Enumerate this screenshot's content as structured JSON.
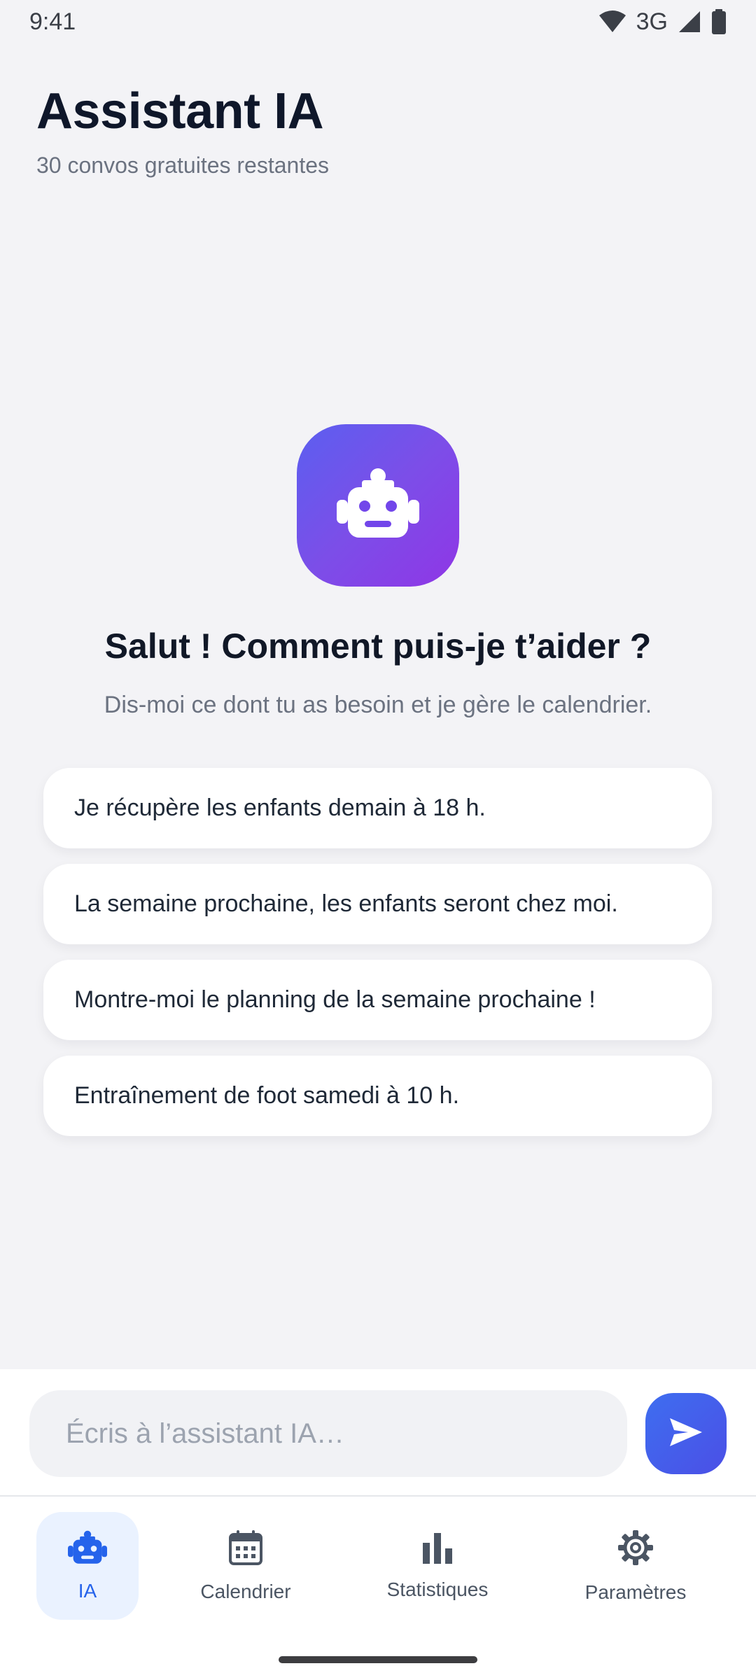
{
  "status_bar": {
    "time": "9:41",
    "network": "3G",
    "icons": [
      "wifi-icon",
      "signal-icon",
      "battery-icon"
    ]
  },
  "header": {
    "title": "Assistant IA",
    "subtitle": "30 convos gratuites restantes"
  },
  "hero": {
    "icon": "robot-icon",
    "greeting": "Salut ! Comment puis-je t’aider ?",
    "subtext": "Dis-moi ce dont tu as besoin et je gère le calendrier."
  },
  "suggestions": [
    "Je récupère les enfants demain à 18 h.",
    "La semaine prochaine, les enfants seront chez moi.",
    "Montre-moi le planning de la semaine prochaine !",
    "Entraînement de foot samedi à 10 h."
  ],
  "input": {
    "placeholder": "Écris à l’assistant IA…",
    "value": "",
    "send_icon": "send-icon"
  },
  "nav": {
    "items": [
      {
        "label": "IA",
        "icon": "robot-icon",
        "active": true
      },
      {
        "label": "Calendrier",
        "icon": "calendar-icon",
        "active": false
      },
      {
        "label": "Statistiques",
        "icon": "bar-chart-icon",
        "active": false
      },
      {
        "label": "Paramètres",
        "icon": "gear-icon",
        "active": false
      }
    ]
  },
  "colors": {
    "background": "#f3f3f6",
    "accent": "#2563eb",
    "gradient_start": "#5b5ff0",
    "gradient_end": "#8f36e6",
    "active_nav_bg": "#eaf2ff"
  }
}
